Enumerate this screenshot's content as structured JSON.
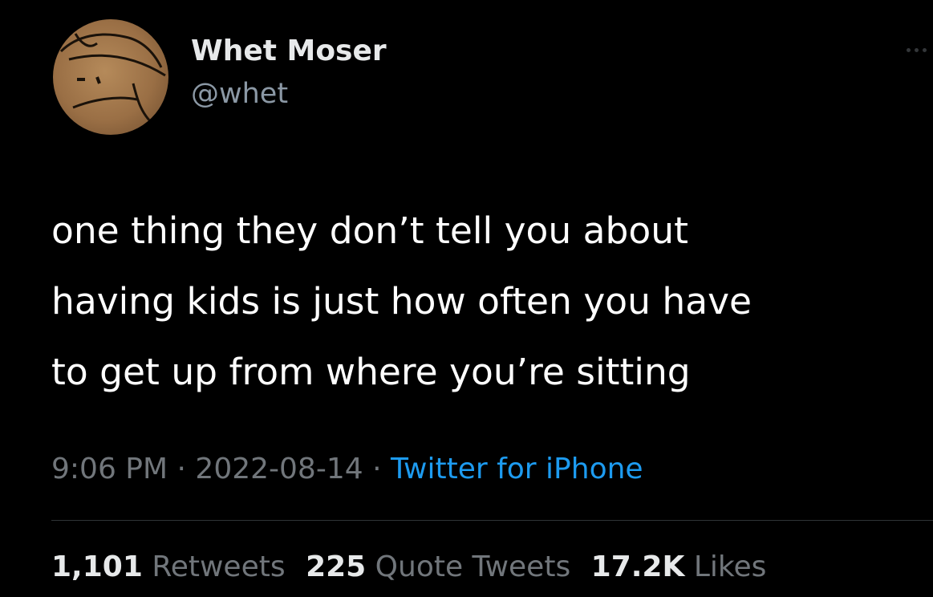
{
  "author": {
    "display_name": "Whet Moser",
    "handle": "@whet"
  },
  "tweet": {
    "lines": [
      "one thing they don’t tell you about",
      "having kids is just how often you have",
      "to get up from where you’re sitting"
    ]
  },
  "meta": {
    "time": "9:06 PM",
    "separator": "·",
    "date": "2022-08-14",
    "source": "Twitter for iPhone"
  },
  "stats": {
    "retweets_count": "1,101",
    "retweets_label": "Retweets",
    "quotes_count": "225",
    "quotes_label": "Quote Tweets",
    "likes_count": "17.2K",
    "likes_label": "Likes"
  },
  "icons": {
    "more": "more-options-icon",
    "avatar": "profile-avatar"
  },
  "colors": {
    "background": "#000000",
    "primary_text": "#e7e9ea",
    "secondary_text": "#71767b",
    "link": "#1d9bf0",
    "divider": "#2f3336"
  }
}
